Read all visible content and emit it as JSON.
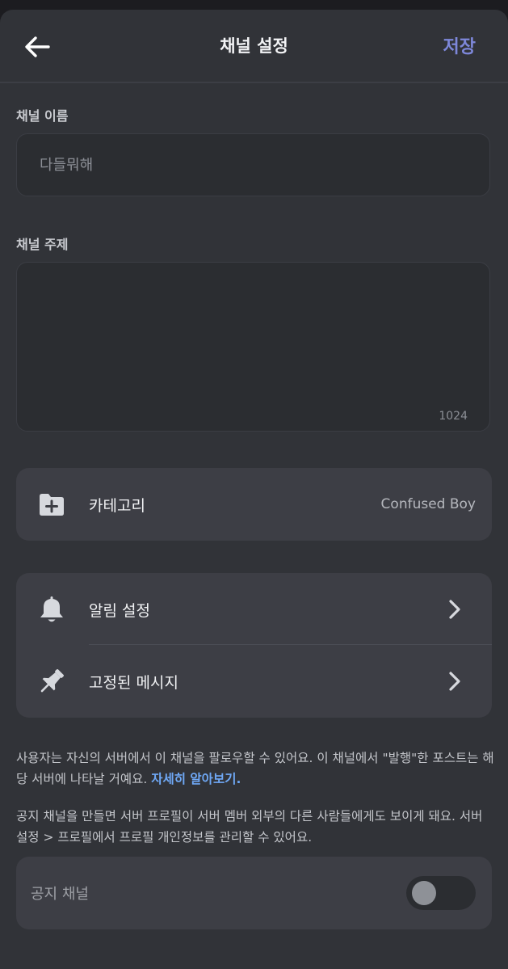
{
  "header": {
    "title": "채널 설정",
    "save_label": "저장",
    "back_icon": "arrow-left-icon"
  },
  "channel_name": {
    "label": "채널 이름",
    "value": "",
    "placeholder": "다들뭐해"
  },
  "channel_topic": {
    "label": "채널 주제",
    "value": "",
    "counter": "1024"
  },
  "category": {
    "icon": "folder-plus-icon",
    "label": "카테고리",
    "value": "Confused Boy"
  },
  "settings_list": [
    {
      "icon": "bell-icon",
      "label": "알림 설정"
    },
    {
      "icon": "pin-icon",
      "label": "고정된 메시지"
    }
  ],
  "follow_info": {
    "text": "사용자는 자신의 서버에서 이 채널을 팔로우할 수 있어요. 이 채널에서 \"발행\"한 포스트는 해당 서버에 나타날 거예요. ",
    "link": "자세히 알아보기."
  },
  "announcement_info": {
    "text": "공지 채널을 만들면 서버 프로필이 서버 멤버 외부의 다른 사람들에게도 보이게 돼요. 서버 설정 > 프로필에서 프로필 개인정보를 관리할 수 있어요."
  },
  "announcement_toggle": {
    "label": "공지 채널",
    "enabled": false
  },
  "colors": {
    "background": "#313338",
    "card": "#3d3e45",
    "accent": "#7d87d9",
    "link": "#6fa8f5"
  }
}
